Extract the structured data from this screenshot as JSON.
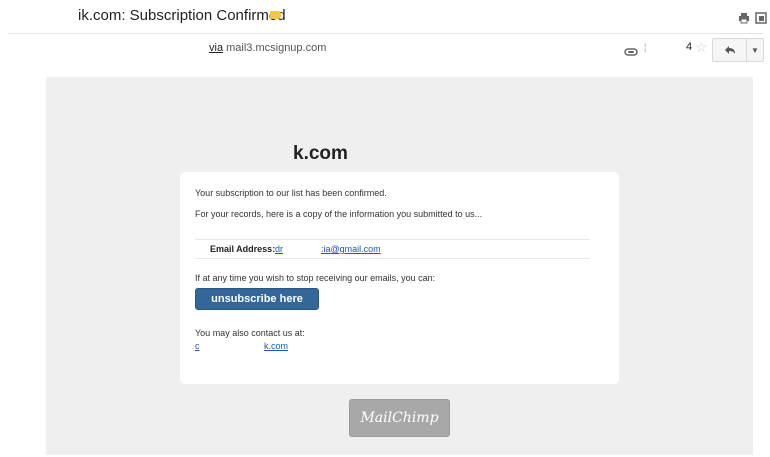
{
  "header": {
    "subject": "ik.com: Subscription Confirmed",
    "label_color": "#f4c542"
  },
  "sender": {
    "via_label": "via",
    "via_domain": "mail3.mcsignup.com",
    "dot": "¦",
    "count": "4"
  },
  "icons": {
    "print": "print-icon",
    "new_window": "new-window-icon",
    "attach": "attachment-icon",
    "star": "star-icon",
    "reply": "reply-icon",
    "more": "chevron-down-icon"
  },
  "body": {
    "brand": "k.com",
    "line1": "Your subscription to our list has been confirmed.",
    "line2": "For your records, here is a copy of the information you submitted to us...",
    "email_label": "Email Address:",
    "email_part1": "dr",
    "email_part2": ":ia@gmail.com",
    "line3": "If at any time you wish to stop receiving our emails, you can:",
    "unsubscribe_label": "unsubscribe here",
    "line4": "You may also contact us at:",
    "contact_part1": "c",
    "contact_part2": "k.com",
    "badge": "MailChimp",
    "button_color": "#336699"
  }
}
